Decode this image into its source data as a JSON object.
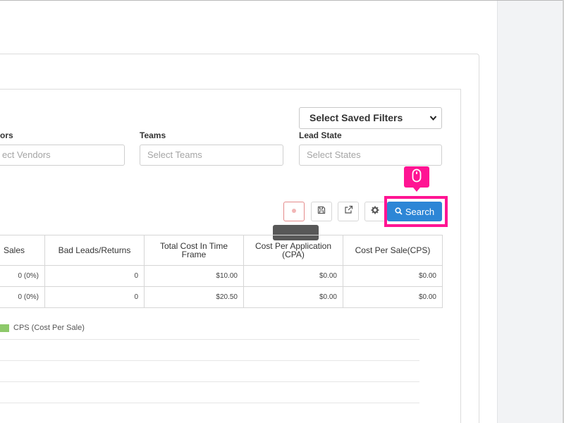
{
  "filters": {
    "saved_filters_label": "Select Saved Filters",
    "vendors": {
      "label": "ors",
      "placeholder": "ect Vendors"
    },
    "teams": {
      "label": "Teams",
      "placeholder": "Select Teams"
    },
    "lead_state": {
      "label": "Lead State",
      "placeholder": "Select States"
    }
  },
  "toolbar": {
    "search_label": "Search"
  },
  "table": {
    "headers": [
      "Sales",
      "Bad Leads/Returns",
      "Total Cost In Time Frame",
      "Cost Per Application (CPA)",
      "Cost Per Sale(CPS)"
    ],
    "rows": [
      [
        "0 (0%)",
        "0",
        "$10.00",
        "$0.00",
        "$0.00"
      ],
      [
        "0 (0%)",
        "0",
        "$20.50",
        "$0.00",
        "$0.00"
      ]
    ]
  },
  "chart": {
    "legend_label": "CPS (Cost Per Sale)",
    "legend_color": "#8dc96a"
  },
  "colors": {
    "accent": "#2d86d6",
    "highlight": "#ff1493"
  },
  "icons": [
    "reset-icon",
    "save-icon",
    "external-link-icon",
    "gear-icon",
    "search-icon",
    "mouse-icon",
    "chevron-down-icon"
  ]
}
